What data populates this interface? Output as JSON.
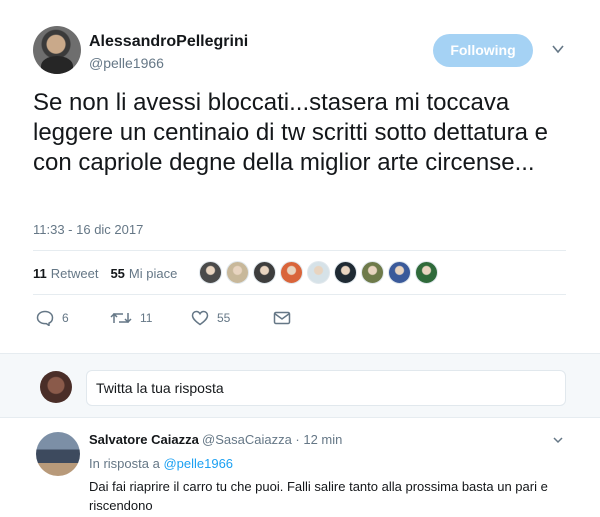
{
  "tweet": {
    "author_name": "AlessandroPellegrini",
    "author_handle": "@pelle1966",
    "follow_label": "Following",
    "text": "Se non li avessi bloccati...stasera mi toccava leggere un centinaio di tw scritti sotto dettatura e con capriole degne della miglior arte circense...",
    "timestamp": "11:33 - 16 dic 2017",
    "retweets_count": "11",
    "retweets_label": "Retweet",
    "likes_count": "55",
    "likes_label": "Mi piace",
    "liker_colors": [
      "#4a4a4a",
      "#c8b89a",
      "#3d3d3d",
      "#d9643a",
      "#d6e2e8",
      "#1f2a33",
      "#6e7a4a",
      "#3a5a9a",
      "#2f6a3a"
    ],
    "actions": {
      "replies": "6",
      "retweets": "11",
      "likes": "55"
    }
  },
  "reply_box": {
    "placeholder": "Twitta la tua risposta"
  },
  "reply": {
    "author_name": "Salvatore Caiazza",
    "author_meta": "@SasaCaiazza · 12 min",
    "in_reply_prefix": "In risposta a",
    "in_reply_handle": "@pelle1966",
    "text": "Dai fai riaprire il carro tu che puoi. Falli salire tanto alla prossima basta un pari e riscendono"
  },
  "colors": {
    "accent": "#1da1f2",
    "follow_bg": "#a5d2f4",
    "muted": "#657786",
    "divider": "#e6ecf0"
  }
}
